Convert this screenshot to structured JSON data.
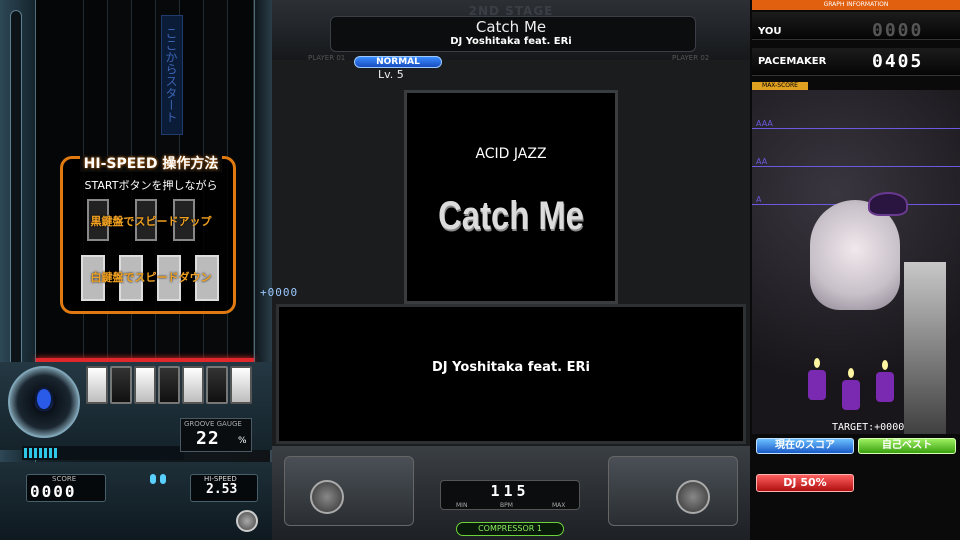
{
  "left_panel": {
    "vertical_label": "ここからスタート",
    "hispeed_help": {
      "title": "HI-SPEED 操作方法",
      "subtitle": "STARTボタンを押しながら",
      "black_keys": "黒鍵盤でスピードアップ",
      "white_keys": "白鍵盤でスピードダウン"
    },
    "groove_gauge": {
      "label": "GROOVE GAUGE",
      "value": "22",
      "unit": "%",
      "fraction": 0.22
    },
    "score": {
      "label": "SCORE",
      "value": "0000"
    },
    "hispeed": {
      "label": "HI-SPEED",
      "value": "2.53"
    }
  },
  "header": {
    "stage": "2ND STAGE",
    "title": "Catch Me",
    "artist": "DJ Yoshitaka feat. ERi",
    "player1": "PLAYER 01",
    "player2": "PLAYER 02",
    "difficulty": "NORMAL",
    "level": "Lv. 5"
  },
  "jacket": {
    "genre": "ACID JAZZ",
    "title": "Catch Me"
  },
  "info_panel": {
    "artist": "DJ Yoshitaka feat. ERi"
  },
  "combo_counter": "+0000",
  "bpm": {
    "value": "115",
    "min_label": "MIN",
    "label": "BPM",
    "max_label": "MAX"
  },
  "compressor": "COMPRESSOR 1",
  "graph": {
    "header": "GRAPH INFORMATION",
    "you_label": "YOU",
    "you_value": "0000",
    "pacemaker_label": "PACEMAKER",
    "pacemaker_value": "0405",
    "max_tag": "MAX-SCORE",
    "lines": [
      "AAA",
      "AA",
      "A"
    ],
    "target": "TARGET:+0000",
    "current_score_btn": "現在のスコア",
    "personal_best_btn": "自己ベスト",
    "dj_level_btn": "DJ 50%"
  },
  "colors": {
    "accent_orange": "#e07a10",
    "judge_red": "#e0282c",
    "graph_purple": "#6b5adf",
    "normal_blue": "#3a8cff"
  }
}
